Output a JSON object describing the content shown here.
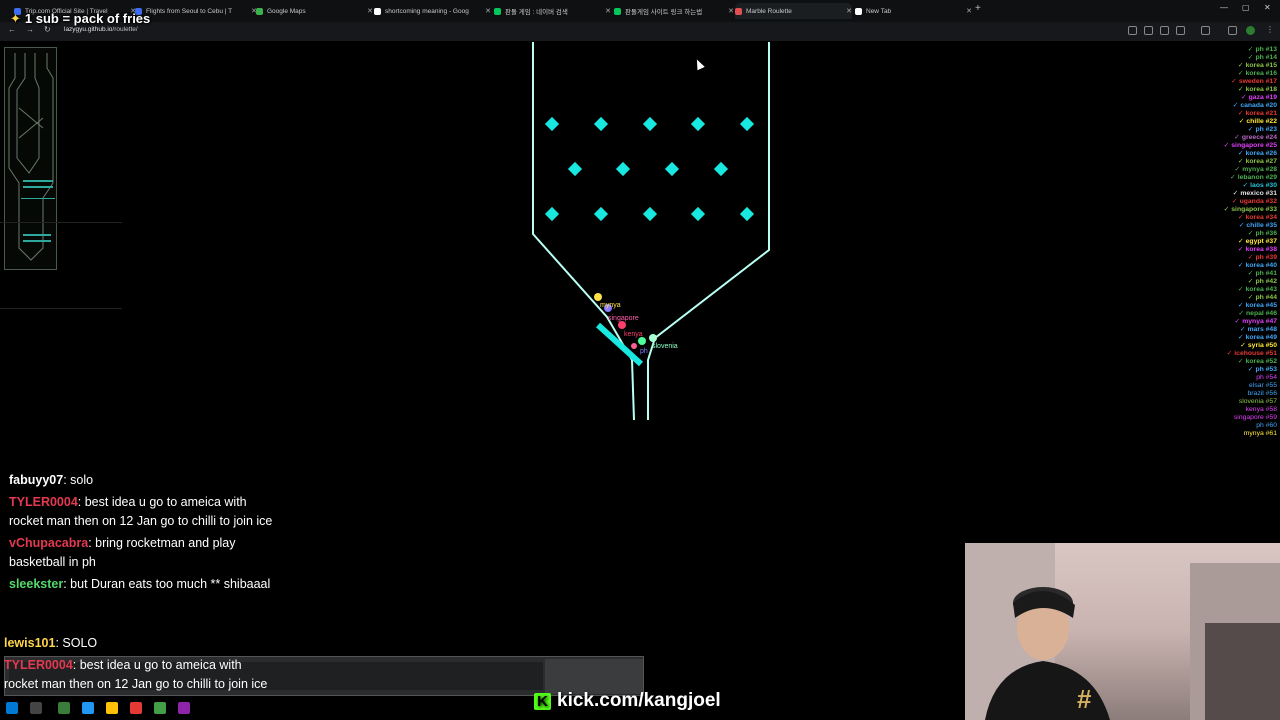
{
  "stream": {
    "sub_banner": "1 sub = pack of fries",
    "kick_url": "kick.com/kangjoel"
  },
  "browser": {
    "tabs": [
      {
        "label": "Trip.com Official Site | Travel",
        "color": "#3c6cf0"
      },
      {
        "label": "Flights from Seoul to Cebu | T",
        "color": "#3c6cf0"
      },
      {
        "label": "Google Maps",
        "color": "#3bb34a"
      },
      {
        "label": "shortcoming meaning - Goog",
        "color": "#ffffff"
      },
      {
        "label": "판돌 게임 : 네이버 검색",
        "color": "#03c75a"
      },
      {
        "label": "판돌게임 사이트 링크 하는법",
        "color": "#03c75a"
      },
      {
        "label": "Marble Roulette",
        "color": "#e05050"
      },
      {
        "label": "New Tab",
        "color": "#ffffff"
      }
    ],
    "active_tab": 6,
    "url_host": "lazygyu.github.io",
    "url_path": "/roulette/"
  },
  "rankings": [
    {
      "name": "ph #13",
      "color": "#4caf50"
    },
    {
      "name": "ph #14",
      "color": "#4caf50"
    },
    {
      "name": "korea #15",
      "color": "#8bc34a"
    },
    {
      "name": "korea #16",
      "color": "#4caf50"
    },
    {
      "name": "sweden #17",
      "color": "#e53935"
    },
    {
      "name": "korea #18",
      "color": "#8bc34a"
    },
    {
      "name": "gaza #19",
      "color": "#e040fb"
    },
    {
      "name": "canada #20",
      "color": "#42a5f5"
    },
    {
      "name": "korea #21",
      "color": "#e53935"
    },
    {
      "name": "chille #22",
      "color": "#ffeb3b"
    },
    {
      "name": "ph #23",
      "color": "#42a5f5"
    },
    {
      "name": "greece #24",
      "color": "#ba68c8"
    },
    {
      "name": "singapore #25",
      "color": "#e040fb"
    },
    {
      "name": "korea #26",
      "color": "#42a5f5"
    },
    {
      "name": "korea #27",
      "color": "#8bc34a"
    },
    {
      "name": "mynya #28",
      "color": "#4caf50"
    },
    {
      "name": "lebanon #29",
      "color": "#4caf50"
    },
    {
      "name": "laos #30",
      "color": "#26c6da"
    },
    {
      "name": "mexico #31",
      "color": "#e0e0e0"
    },
    {
      "name": "uganda #32",
      "color": "#e53935"
    },
    {
      "name": "singapore #33",
      "color": "#8bc34a"
    },
    {
      "name": "korea #34",
      "color": "#e53935"
    },
    {
      "name": "chille #35",
      "color": "#42a5f5"
    },
    {
      "name": "ph #36",
      "color": "#4caf50"
    },
    {
      "name": "egypt #37",
      "color": "#ffeb3b"
    },
    {
      "name": "korea #38",
      "color": "#e040fb"
    },
    {
      "name": "ph #39",
      "color": "#e53935"
    },
    {
      "name": "korea #40",
      "color": "#42a5f5"
    },
    {
      "name": "ph #41",
      "color": "#4caf50"
    },
    {
      "name": "ph #42",
      "color": "#8bc34a"
    },
    {
      "name": "korea #43",
      "color": "#4caf50"
    },
    {
      "name": "ph #44",
      "color": "#8bc34a"
    },
    {
      "name": "korea #45",
      "color": "#42a5f5"
    },
    {
      "name": "nepal #46",
      "color": "#4caf50"
    },
    {
      "name": "mynya #47",
      "color": "#e040fb"
    },
    {
      "name": "mars #48",
      "color": "#42a5f5"
    },
    {
      "name": "korea #49",
      "color": "#42a5f5"
    },
    {
      "name": "syria #50",
      "color": "#ffeb3b"
    },
    {
      "name": "icehouse #51",
      "color": "#e53935"
    },
    {
      "name": "korea #52",
      "color": "#4caf50"
    },
    {
      "name": "ph #53",
      "color": "#42a5f5"
    },
    {
      "name": "ph #54",
      "color": "#e040fb"
    },
    {
      "name": "elsar #55",
      "color": "#42a5f5"
    },
    {
      "name": "brazil #56",
      "color": "#42a5f5"
    },
    {
      "name": "slovenia #57",
      "color": "#8bc34a"
    },
    {
      "name": "kenya #58",
      "color": "#e040fb"
    },
    {
      "name": "singapore #59",
      "color": "#e040fb"
    },
    {
      "name": "ph #60",
      "color": "#42a5f5"
    },
    {
      "name": "mynya #61",
      "color": "#ffeb3b"
    }
  ],
  "marble_labels": [
    "mynya",
    "singapore",
    "kenya",
    "slovenia",
    "ph"
  ],
  "chat": [
    {
      "user": "fabuyy07",
      "text": ": solo",
      "color": "#ffffff"
    },
    {
      "user": "TYLER0004",
      "text": ": best idea u go to ameica with rocket man then on 12 Jan go to chilli to join ice",
      "color": "#e53950"
    },
    {
      "user": "vChupacabra",
      "text": ": bring rocketman and play basketball in ph",
      "color": "#e53950"
    },
    {
      "user": "sleekster",
      "text": ": but Duran eats too much ** shibaaal",
      "color": "#53d86a"
    }
  ],
  "chat_bottom": [
    {
      "user": "lewis101",
      "text": ": SOLO",
      "color": "#ffd54a"
    },
    {
      "user": "TYLER0004",
      "text": ": best idea u go to ameica with rocket man then on 12 Jan go to chilli to join ice",
      "color": "#e53950"
    }
  ]
}
